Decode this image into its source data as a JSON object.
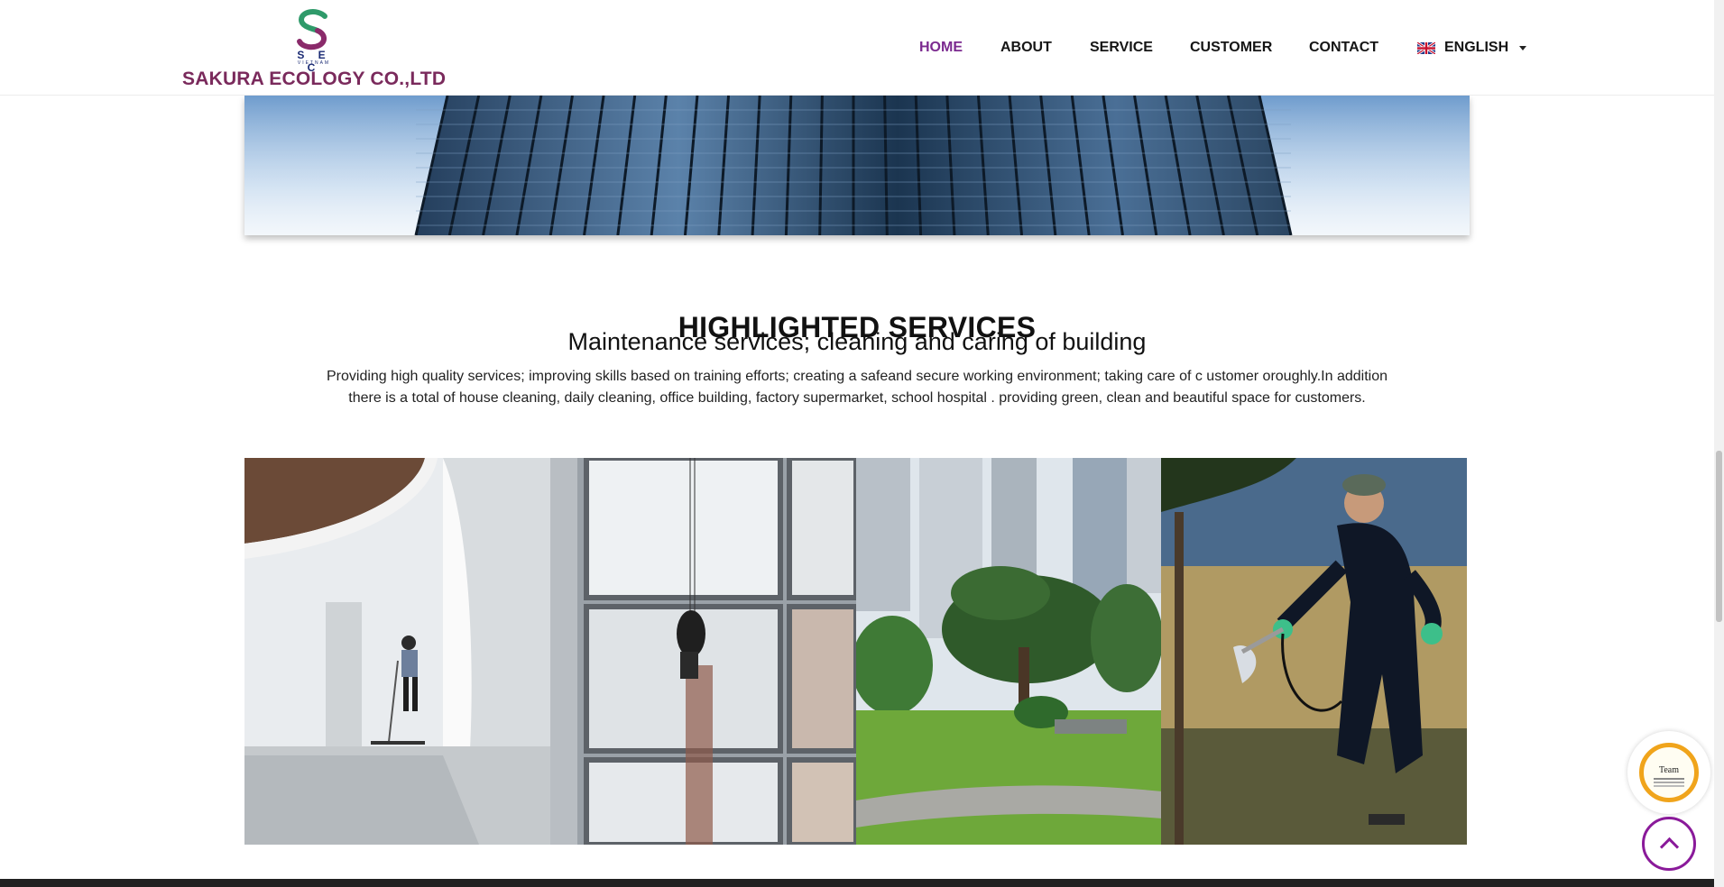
{
  "header": {
    "logo_letters": "S E C",
    "logo_subtext": "VIETNAM",
    "company_name": "SAKURA ECOLOGY CO.,LTD",
    "nav": [
      {
        "label": "HOME",
        "active": true
      },
      {
        "label": "ABOUT",
        "active": false
      },
      {
        "label": "SERVICE",
        "active": false
      },
      {
        "label": "CUSTOMER",
        "active": false
      },
      {
        "label": "CONTACT",
        "active": false
      }
    ],
    "language": {
      "label": "ENGLISH",
      "flag_icon": "uk-flag-icon"
    }
  },
  "section": {
    "title": "HIGHLIGHTED SERVICES",
    "subtitle": "Maintenance services; cleaning and caring of building",
    "description_line1": "Providing high quality services; improving skills based on training efforts; creating a safeand secure working environment; taking care of c ustomer oroughly.In addition",
    "description_line2": "there is a total of house cleaning, daily cleaning, office building, factory supermarket, school hospital . providing green, clean and beautiful space for customers."
  },
  "gallery": [
    {
      "name": "floor-cleaning-photo"
    },
    {
      "name": "window-cleaning-photo"
    },
    {
      "name": "landscaping-photo"
    },
    {
      "name": "pest-control-photo"
    }
  ],
  "floating": {
    "badge_text": "Team",
    "scroll_top_icon": "chevron-up-icon"
  },
  "colors": {
    "brand": "#7a2a5c",
    "nav_active": "#7b2a8f",
    "scroll_button": "#8a1a9a",
    "badge_ring": "#f0a41b"
  }
}
